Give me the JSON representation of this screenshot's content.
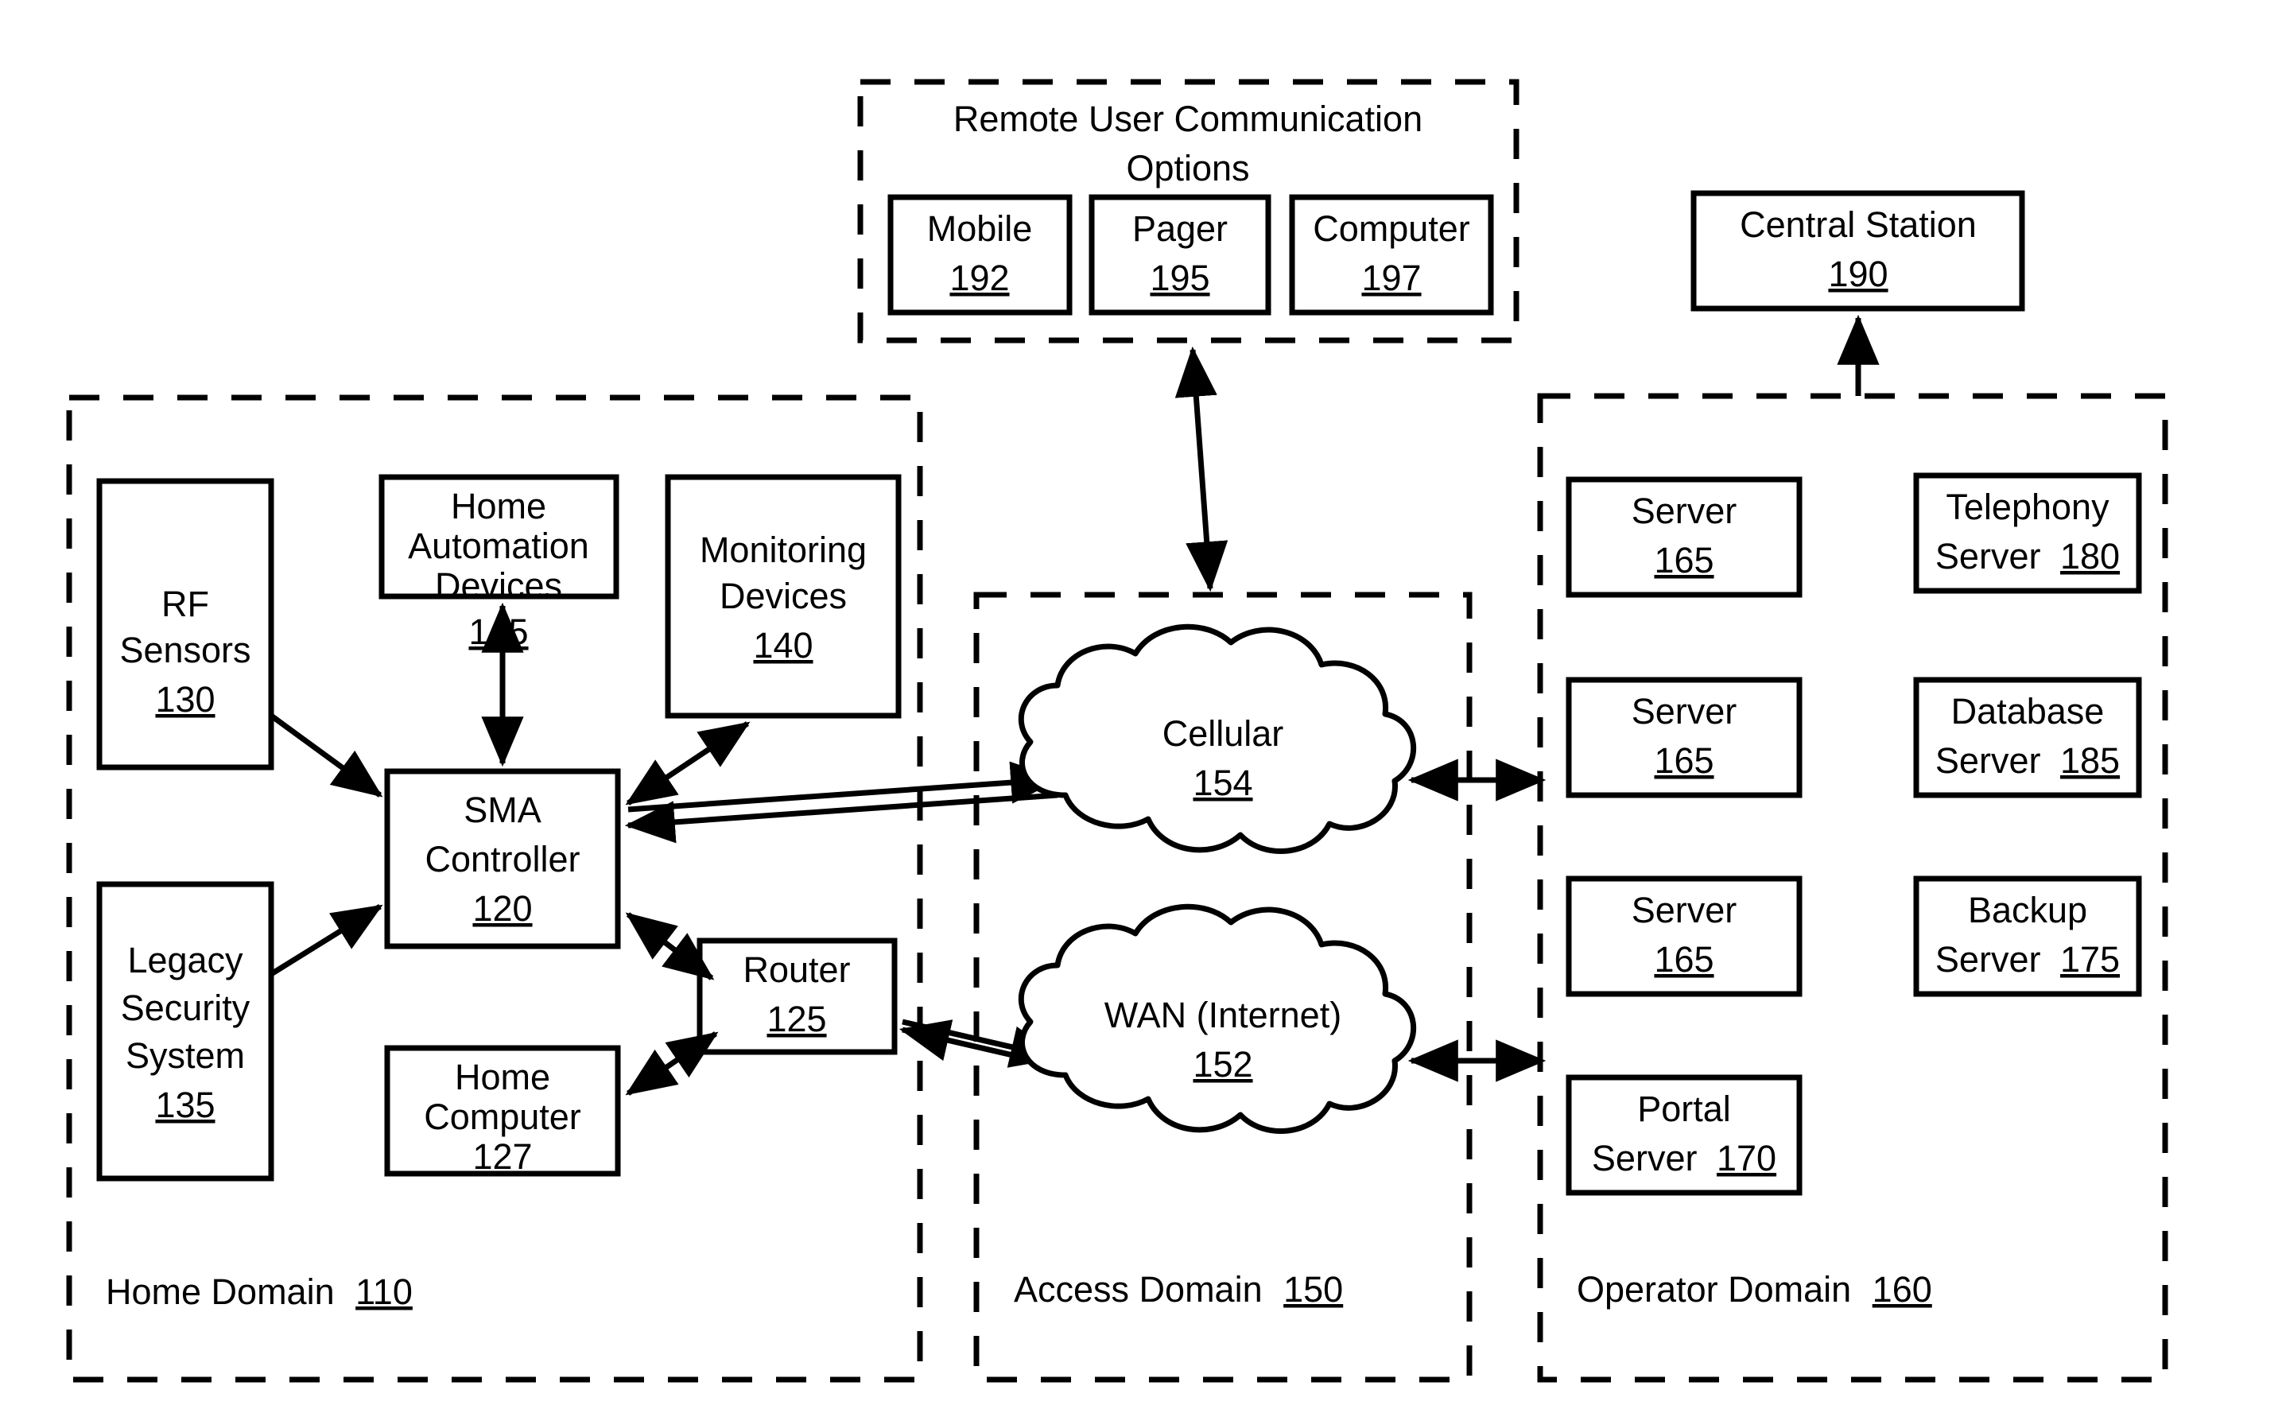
{
  "figure": {
    "type": "system-architecture-block-diagram",
    "style": "patent-line-drawing",
    "background": "#ffffff",
    "ink": "#000000"
  },
  "regions": [
    {
      "id": "remote-user-options",
      "title_line1": "Remote User Communication",
      "title_line2": "Options",
      "border": "dashed"
    },
    {
      "id": "home-domain",
      "label_text": "Home Domain",
      "label_ref": "110",
      "border": "dashed"
    },
    {
      "id": "access-domain",
      "label_text": "Access Domain",
      "label_ref": "150",
      "border": "dashed"
    },
    {
      "id": "operator-domain",
      "label_text": "Operator Domain",
      "label_ref": "160",
      "border": "dashed"
    }
  ],
  "nodes": {
    "mobile": {
      "lines": [
        "Mobile"
      ],
      "ref": "192"
    },
    "pager": {
      "lines": [
        "Pager"
      ],
      "ref": "195"
    },
    "computer": {
      "lines": [
        "Computer"
      ],
      "ref": "197"
    },
    "central_station": {
      "lines": [
        "Central Station"
      ],
      "ref": "190"
    },
    "rf_sensors": {
      "lines": [
        "RF",
        "Sensors"
      ],
      "ref": "130"
    },
    "home_automation": {
      "lines": [
        "Home",
        "Automation",
        "Devices"
      ],
      "ref": "145"
    },
    "monitoring_devices": {
      "lines": [
        "Monitoring",
        "Devices"
      ],
      "ref": "140"
    },
    "sma_controller": {
      "lines": [
        "SMA",
        "Controller"
      ],
      "ref": "120"
    },
    "legacy_security": {
      "lines": [
        "Legacy",
        "Security",
        "System"
      ],
      "ref": "135"
    },
    "router": {
      "lines": [
        "Router"
      ],
      "ref": "125"
    },
    "home_computer": {
      "lines": [
        "Home",
        "Computer"
      ],
      "ref": "127"
    },
    "cellular": {
      "lines": [
        "Cellular"
      ],
      "ref": "154"
    },
    "wan": {
      "lines": [
        "WAN (Internet)"
      ],
      "ref": "152"
    },
    "server_1": {
      "lines": [
        "Server"
      ],
      "ref": "165"
    },
    "server_2": {
      "lines": [
        "Server"
      ],
      "ref": "165"
    },
    "server_3": {
      "lines": [
        "Server"
      ],
      "ref": "165"
    },
    "portal_server": {
      "lines": [
        "Portal"
      ],
      "inline": "Server",
      "ref": "170"
    },
    "telephony_server": {
      "lines": [
        "Telephony"
      ],
      "inline": "Server",
      "ref": "180"
    },
    "database_server": {
      "lines": [
        "Database"
      ],
      "inline": "Server",
      "ref": "185"
    },
    "backup_server": {
      "lines": [
        "Backup"
      ],
      "inline": "Server",
      "ref": "175"
    }
  },
  "connections": [
    {
      "from": "rf_sensors",
      "to": "sma_controller",
      "heads": "single"
    },
    {
      "from": "legacy_security",
      "to": "sma_controller",
      "heads": "single"
    },
    {
      "from": "home_automation",
      "to": "sma_controller",
      "heads": "double"
    },
    {
      "from": "monitoring_devices",
      "to": "sma_controller",
      "heads": "double"
    },
    {
      "from": "sma_controller",
      "to": "router",
      "heads": "double"
    },
    {
      "from": "home_computer",
      "to": "router",
      "heads": "double"
    },
    {
      "from": "sma_controller",
      "to": "cellular",
      "heads": "double-split"
    },
    {
      "from": "router",
      "to": "wan",
      "heads": "double-split"
    },
    {
      "from": "cellular",
      "to": "operator-domain",
      "heads": "double"
    },
    {
      "from": "wan",
      "to": "operator-domain",
      "heads": "double"
    },
    {
      "from": "access-domain",
      "to": "remote-user-options",
      "heads": "double"
    },
    {
      "from": "operator-domain",
      "to": "central_station",
      "heads": "single"
    }
  ]
}
